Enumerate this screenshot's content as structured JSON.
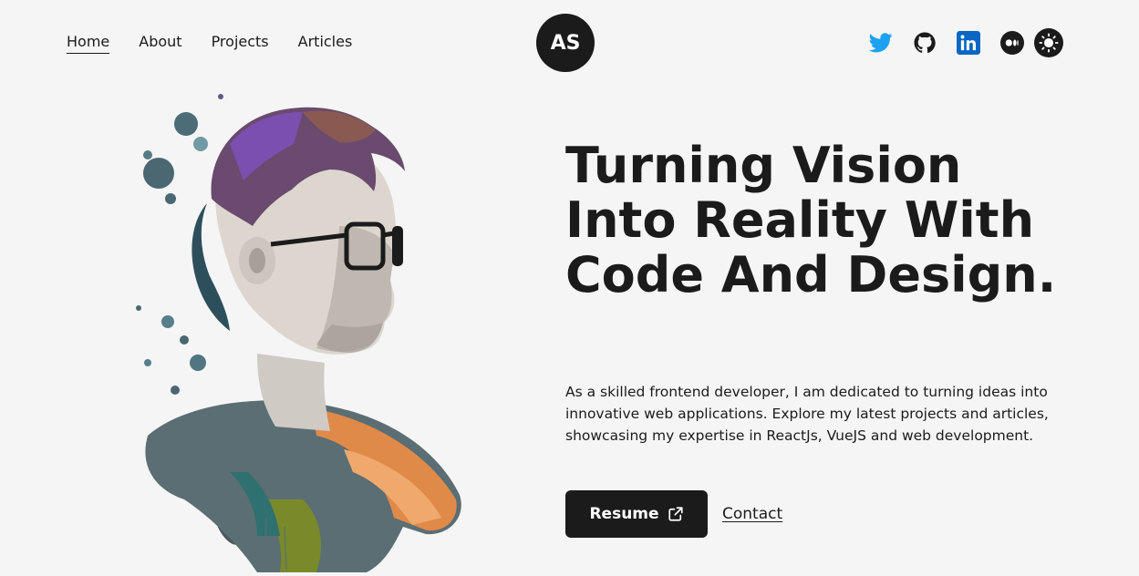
{
  "nav": {
    "items": [
      {
        "label": "Home",
        "active": true
      },
      {
        "label": "About",
        "active": false
      },
      {
        "label": "Projects",
        "active": false
      },
      {
        "label": "Articles",
        "active": false
      }
    ]
  },
  "logo": {
    "initials": "AS"
  },
  "social": [
    {
      "icon": "twitter-icon",
      "color": "#1da1f2"
    },
    {
      "icon": "github-icon",
      "color": "#1b1b1b"
    },
    {
      "icon": "linkedin-icon",
      "color": "#0a66c2"
    },
    {
      "icon": "medium-icon",
      "color": "#1b1b1b"
    },
    {
      "icon": "sun-icon",
      "color": "#ffffff"
    }
  ],
  "hero": {
    "image": "watercolor-portrait-of-man-with-glasses",
    "headline": "Turning Vision Into Reality With Code And Design.",
    "intro": "As a skilled frontend developer, I am dedicated to turning ideas into innovative web applications. Explore my latest projects and articles, showcasing my expertise in ReactJs, VueJS and web development.",
    "resume_label": "Resume",
    "contact_label": "Contact"
  },
  "colors": {
    "background": "#f5f5f5",
    "dark": "#1b1b1b"
  }
}
